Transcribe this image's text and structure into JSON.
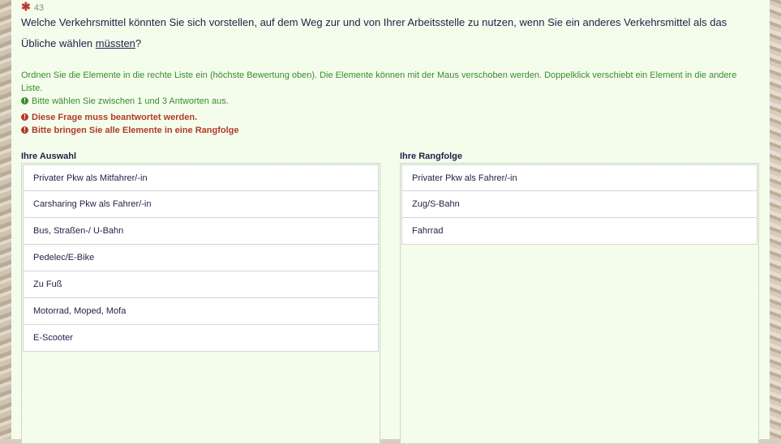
{
  "question": {
    "number": "43",
    "text_before": "Welche Verkehrsmittel könnten Sie sich vorstellen, auf dem Weg zur und von Ihrer Arbeitsstelle zu nutzen, wenn Sie ein anderes Verkehrsmittel als das Übliche wählen ",
    "text_underlined": "müssten",
    "text_after": "?"
  },
  "help": {
    "instruction": "Ordnen Sie die Elemente in die rechte Liste ein (höchste Bewertung oben). Die Elemente können mit der Maus verschoben werden. Doppelklick verschiebt ein Element in die andere Liste.",
    "tip": "Bitte wählen Sie zwischen 1 und 3 Antworten aus.",
    "error_required": "Diese Frage muss beantwortet werden.",
    "error_rank": "Bitte bringen Sie alle Elemente in eine Rangfolge"
  },
  "left_list": {
    "title": "Ihre Auswahl",
    "items": [
      "Privater Pkw als Mitfahrer/-in",
      "Carsharing Pkw als Fahrer/-in",
      "Bus, Straßen-/ U-Bahn",
      "Pedelec/E-Bike",
      "Zu Fuß",
      "Motorrad, Moped, Mofa",
      "E-Scooter"
    ]
  },
  "right_list": {
    "title": "Ihre Rangfolge",
    "items": [
      "Privater Pkw als Fahrer/-in",
      "Zug/S-Bahn",
      "Fahrrad"
    ]
  },
  "colors": {
    "panel_bg": "#f4fdec",
    "help_green": "#3b8a2e",
    "error_red": "#b23a2a",
    "text_dark": "#1d2148"
  }
}
